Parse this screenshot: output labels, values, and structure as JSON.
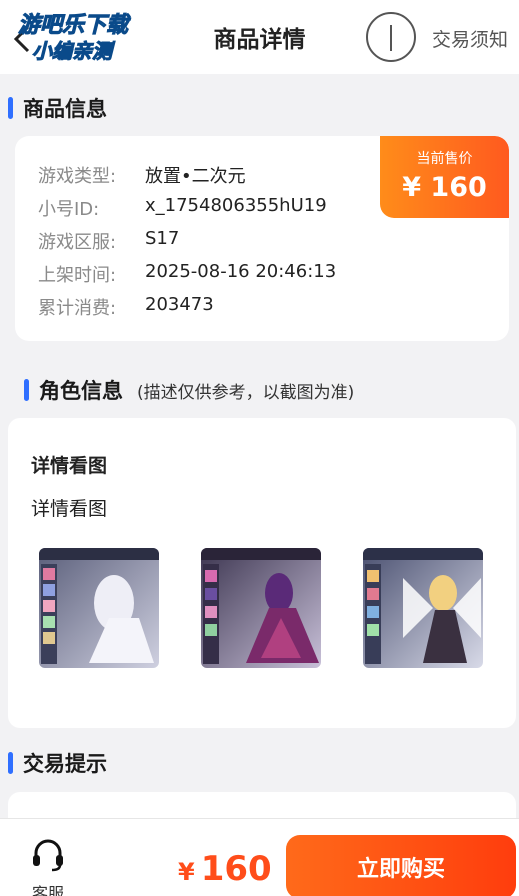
{
  "header": {
    "title": "商品详情",
    "notice_label": "交易须知",
    "watermark_line1": "游吧乐下载",
    "watermark_line2": "小编亲测"
  },
  "product_section": {
    "title": "商品信息",
    "rows": [
      {
        "label": "游戏类型:",
        "value": "放置•二次元"
      },
      {
        "label": "小号ID:",
        "value": "x_1754806355hU19"
      },
      {
        "label": "游戏区服:",
        "value": "S17"
      },
      {
        "label": "上架时间:",
        "value": "2025-08-16 20:46:13"
      },
      {
        "label": "累计消费:",
        "value": "203473"
      }
    ],
    "price_caption": "当前售价",
    "price": "¥ 160"
  },
  "role_section": {
    "title": "角色信息",
    "subtitle": "(描述仅供参考，以截图为准)",
    "detail_title": "详情看图",
    "detail_sub": "详情看图",
    "thumbnails": [
      "screenshot-1",
      "screenshot-2",
      "screenshot-3"
    ]
  },
  "tips_section": {
    "title": "交易提示"
  },
  "bottom_bar": {
    "service_label": "客服",
    "currency": "¥",
    "price": "160",
    "buy_label": "立即购买"
  },
  "colors": {
    "accent_blue": "#2f6fff",
    "price_orange": "#ff5a1f",
    "buy_button": "#ff4d1a"
  }
}
